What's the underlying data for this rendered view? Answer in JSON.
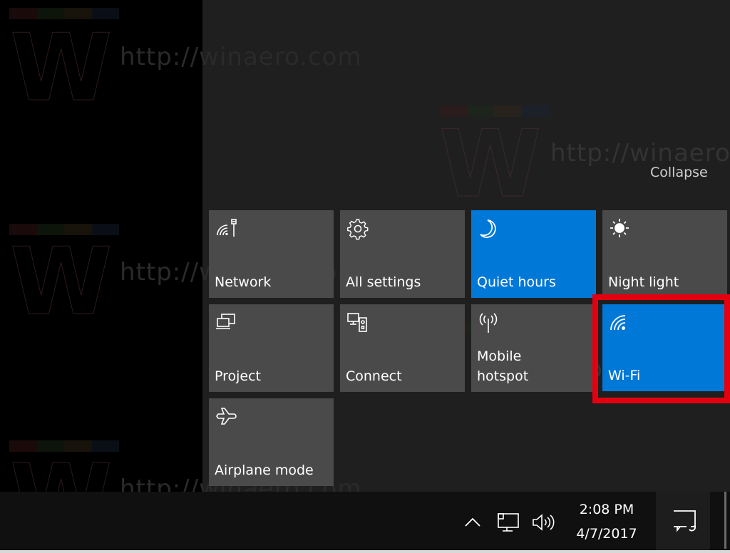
{
  "watermark": {
    "text": "http://winaero.com",
    "letter": "W"
  },
  "action_center": {
    "collapse_label": "Collapse",
    "accent_color": "#0078d7",
    "tile_color": "#4a4a4a",
    "highlight_color": "#e5000f",
    "tiles": [
      {
        "label": "Network",
        "icon": "network-icon",
        "active": false
      },
      {
        "label": "All settings",
        "icon": "gear-icon",
        "active": false
      },
      {
        "label": "Quiet hours",
        "icon": "moon-icon",
        "active": true
      },
      {
        "label": "Night light",
        "icon": "sun-icon",
        "active": false
      },
      {
        "label": "Project",
        "icon": "project-icon",
        "active": false
      },
      {
        "label": "Connect",
        "icon": "connect-icon",
        "active": false
      },
      {
        "label": "Mobile\nhotspot",
        "label_line1": "Mobile",
        "label_line2": "hotspot",
        "icon": "hotspot-icon",
        "active": false
      },
      {
        "label": "Wi-Fi",
        "icon": "wifi-icon",
        "active": true,
        "highlighted": true
      },
      {
        "label": "Airplane mode",
        "icon": "airplane-icon",
        "active": false
      }
    ]
  },
  "taskbar": {
    "tray_icons": [
      "chevron-up-icon",
      "network-wired-icon",
      "volume-icon"
    ],
    "time": "2:08 PM",
    "date": "4/7/2017",
    "action_center_icon": "action-center-icon"
  }
}
